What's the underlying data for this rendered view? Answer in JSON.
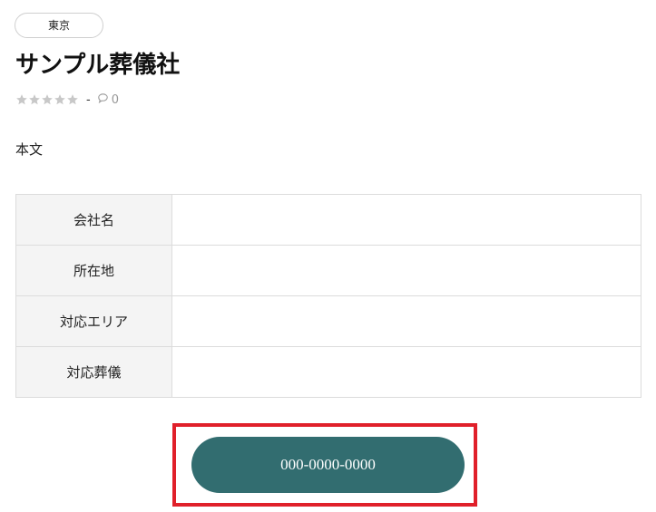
{
  "tag": {
    "label": "東京"
  },
  "title": "サンプル葬儀社",
  "meta": {
    "rating": 0,
    "max_rating": 5,
    "separator": "-",
    "comment_count": "0"
  },
  "body_text": "本文",
  "info_table": {
    "rows": [
      {
        "label": "会社名",
        "value": ""
      },
      {
        "label": "所在地",
        "value": ""
      },
      {
        "label": "対応エリア",
        "value": ""
      },
      {
        "label": "対応葬儀",
        "value": ""
      }
    ]
  },
  "phone_button": {
    "label": "000-0000-0000"
  },
  "colors": {
    "button_bg": "#326d70",
    "highlight_border": "#e0202a",
    "star_empty": "#c8c8c8"
  }
}
